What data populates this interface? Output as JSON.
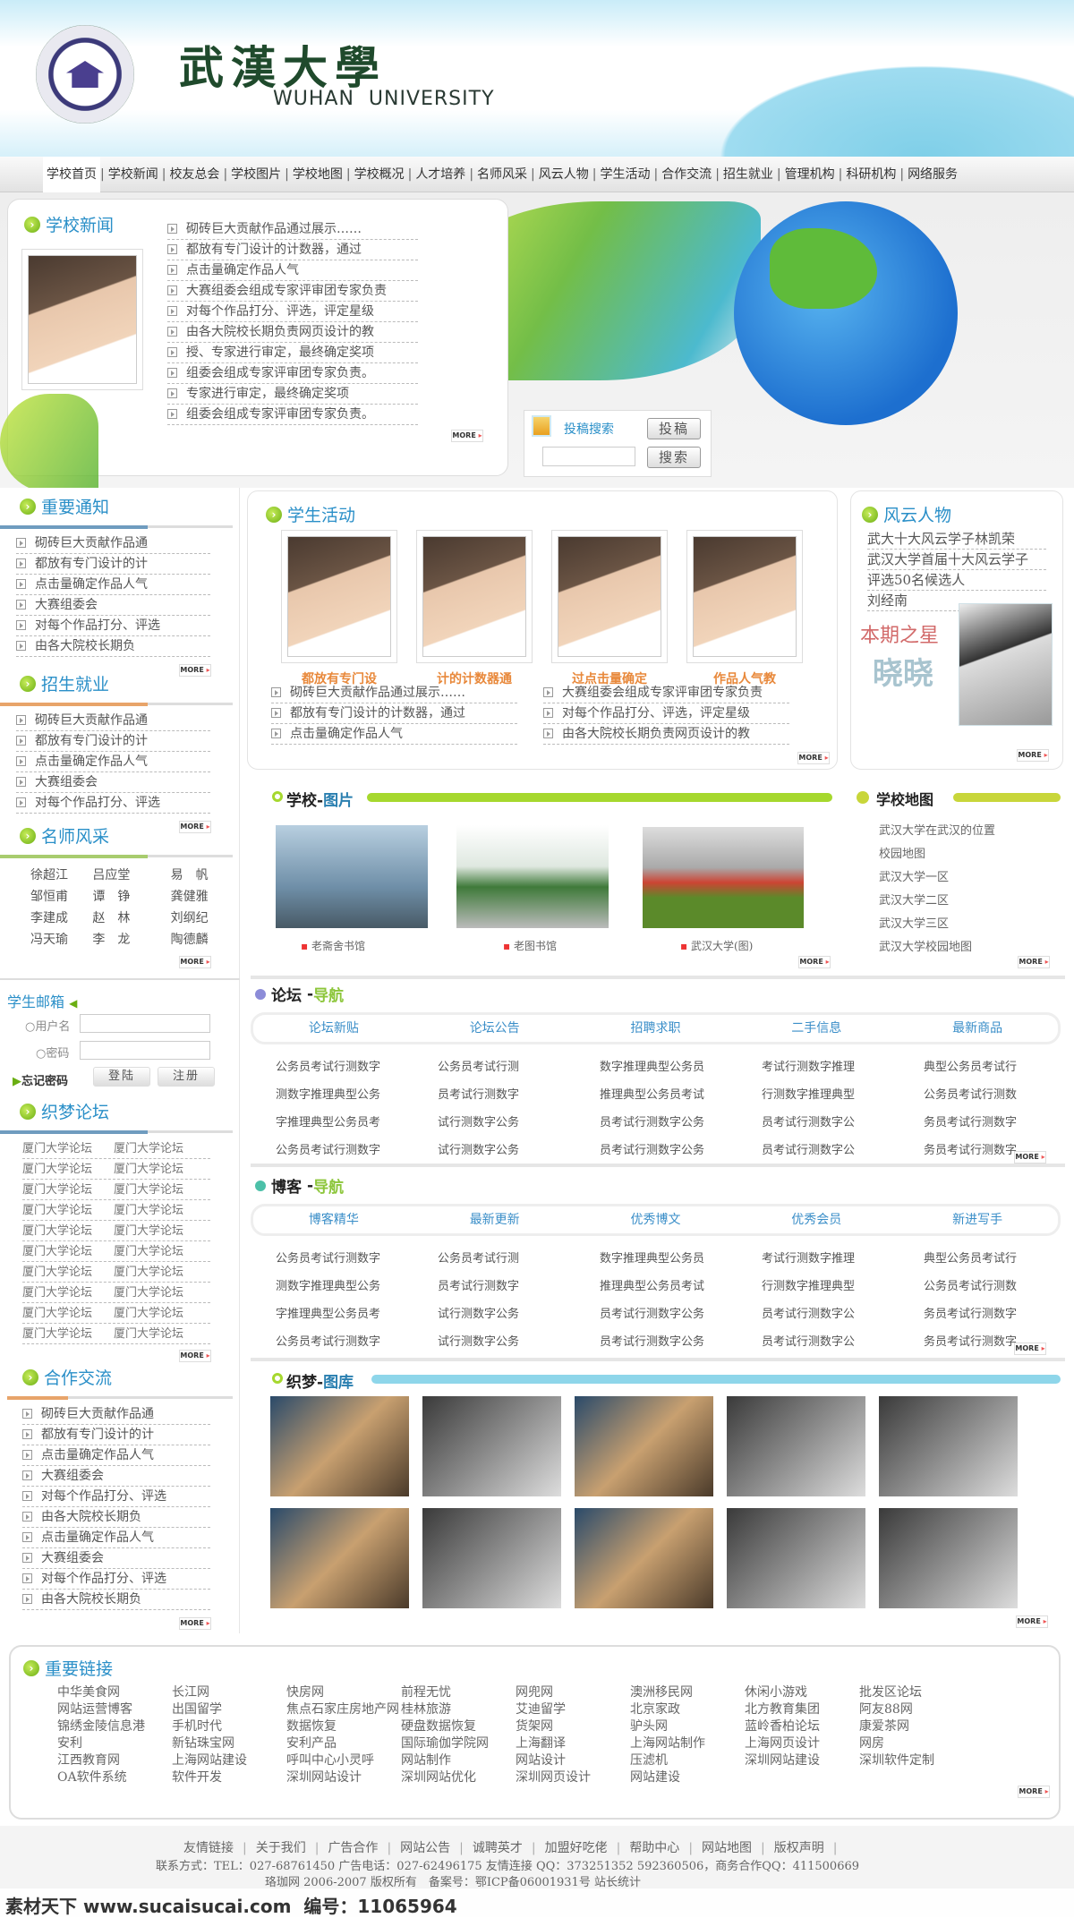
{
  "header": {
    "title_cn": "武漢大學",
    "title_en": "WUHAN  UNIVERSITY",
    "logo_text": "WUHAN UNIVERSITY"
  },
  "nav": [
    "学校首页",
    "学校新闻",
    "校友总会",
    "学校图片",
    "学校地图",
    "学校概况",
    "人才培养",
    "名师风采",
    "风云人物",
    "学生活动",
    "合作交流",
    "招生就业",
    "管理机构",
    "科研机构",
    "网络服务"
  ],
  "more_label": "MORE",
  "news": {
    "title": "学校新闻",
    "items": [
      "砌砖巨大贡献作品通过展示……",
      "都放有专门设计的计数器，通过",
      "点击量确定作品人气",
      "大赛组委会组成专家评审团专家负责",
      "对每个作品打分、评选，评定星级",
      "由各大院校长期负责网页设计的教",
      "授、专家进行审定，最终确定奖项",
      "组委会组成专家评审团专家负责。",
      "专家进行审定，最终确定奖项",
      "组委会组成专家评审团专家负责。"
    ]
  },
  "search": {
    "title": "投稿搜索",
    "submit_label": "投稿",
    "search_label": "搜索",
    "value": ""
  },
  "notice": {
    "title": "重要通知",
    "items": [
      "砌砖巨大贡献作品通",
      "都放有专门设计的计",
      "点击量确定作品人气",
      "大赛组委会",
      "对每个作品打分、评选",
      "由各大院校长期负"
    ]
  },
  "admission": {
    "title": "招生就业",
    "items": [
      "砌砖巨大贡献作品通",
      "都放有专门设计的计",
      "点击量确定作品人气",
      "大赛组委会",
      "对每个作品打分、评选"
    ]
  },
  "teachers": {
    "title": "名师风采",
    "rows": [
      [
        "徐超江",
        "吕应堂",
        "易　帆"
      ],
      [
        "邹恒甫",
        "谭　铮",
        "龚健雅"
      ],
      [
        "李建成",
        "赵　林",
        "刘纲纪"
      ],
      [
        "冯天瑜",
        "李　龙",
        "陶德麟"
      ]
    ]
  },
  "activities": {
    "title": "学生活动",
    "captions": [
      "都放有专门设",
      "计的计数器通",
      "过点击量确定",
      "作品人气教"
    ],
    "left_items": [
      "砌砖巨大贡献作品通过展示……",
      "都放有专门设计的计数器，通过",
      "点击量确定作品人气"
    ],
    "right_items": [
      "大赛组委会组成专家评审团专家负责",
      "对每个作品打分、评选，评定星级",
      "由各大院校长期负责网页设计的教"
    ]
  },
  "people": {
    "title": "风云人物",
    "items": [
      "武大十大风云学子林凯荣",
      "武汉大学首届十大风云学子",
      "评选50名候选人",
      "刘经南"
    ],
    "star_label": "本期之星",
    "star_name": "晓晓"
  },
  "pictures": {
    "title_a": "学校",
    "title_b": "图片",
    "captions": [
      "老斋舍书馆",
      "老图书馆",
      "武汉大学(图)"
    ]
  },
  "map": {
    "title": "学校地图",
    "items": [
      "武汉大学在武汉的位置",
      "校园地图",
      "武汉大学一区",
      "武汉大学二区",
      "武汉大学三区",
      "武汉大学校园地图"
    ]
  },
  "mail": {
    "title": "学生邮箱",
    "username_label": "○用户名",
    "password_label": "○密码",
    "username": "",
    "password": "",
    "forgot_label": "忘记密码",
    "login_label": "登陆",
    "register_label": "注册"
  },
  "forum_list": {
    "title": "织梦论坛",
    "rows": [
      [
        "厦门大学论坛",
        "厦门大学论坛"
      ],
      [
        "厦门大学论坛",
        "厦门大学论坛"
      ],
      [
        "厦门大学论坛",
        "厦门大学论坛"
      ],
      [
        "厦门大学论坛",
        "厦门大学论坛"
      ],
      [
        "厦门大学论坛",
        "厦门大学论坛"
      ],
      [
        "厦门大学论坛",
        "厦门大学论坛"
      ],
      [
        "厦门大学论坛",
        "厦门大学论坛"
      ],
      [
        "厦门大学论坛",
        "厦门大学论坛"
      ],
      [
        "厦门大学论坛",
        "厦门大学论坛"
      ],
      [
        "厦门大学论坛",
        "厦门大学论坛"
      ]
    ]
  },
  "coop": {
    "title": "合作交流",
    "items": [
      "砌砖巨大贡献作品通",
      "都放有专门设计的计",
      "点击量确定作品人气",
      "大赛组委会",
      "对每个作品打分、评选",
      "由各大院校长期负",
      "点击量确定作品人气",
      "大赛组委会",
      "对每个作品打分、评选",
      "由各大院校长期负"
    ]
  },
  "forum_nav": {
    "title_a": "论坛",
    "title_b": "导航",
    "tabs": [
      "论坛新贴",
      "论坛公告",
      "招聘求职",
      "二手信息",
      "最新商品"
    ],
    "rows": [
      [
        "公务员考试行测数字",
        "公务员考试行测",
        "数字推理典型公务员",
        "考试行测数字推理",
        "典型公务员考试行"
      ],
      [
        "测数字推理典型公务",
        "员考试行测数字",
        "推理典型公务员考试",
        "行测数字推理典型",
        "公务员考试行测数"
      ],
      [
        "字推理典型公务员考",
        "试行测数字公务",
        "员考试行测数字公务",
        "员考试行测数字公",
        "务员考试行测数字"
      ],
      [
        "公务员考试行测数字",
        "试行测数字公务",
        "员考试行测数字公务",
        "员考试行测数字公",
        "务员考试行测数字"
      ]
    ]
  },
  "blog_nav": {
    "title_a": "博客",
    "title_b": "导航",
    "tabs": [
      "博客精华",
      "最新更新",
      "优秀博文",
      "优秀会员",
      "新进写手"
    ],
    "rows": [
      [
        "公务员考试行测数字",
        "公务员考试行测",
        "数字推理典型公务员",
        "考试行测数字推理",
        "典型公务员考试行"
      ],
      [
        "测数字推理典型公务",
        "员考试行测数字",
        "推理典型公务员考试",
        "行测数字推理典型",
        "公务员考试行测数"
      ],
      [
        "字推理典型公务员考",
        "试行测数字公务",
        "员考试行测数字公务",
        "员考试行测数字公",
        "务员考试行测数字"
      ],
      [
        "公务员考试行测数字",
        "试行测数字公务",
        "员考试行测数字公务",
        "员考试行测数字公",
        "务员考试行测数字"
      ]
    ]
  },
  "gallery": {
    "title_a": "织梦",
    "title_b": "图库"
  },
  "links": {
    "title": "重要链接",
    "columns": [
      [
        "中华美食网",
        "网站运营博客",
        "锦绣金陵信息港",
        "安利",
        "江西教育网",
        "OA软件系统"
      ],
      [
        "长江网",
        "出国留学",
        "手机时代",
        "新钻珠宝网",
        "上海网站建设",
        "软件开发"
      ],
      [
        "快房网",
        "焦点石家庄房地产网",
        "数据恢复",
        "安利产品",
        "呼叫中心小灵呼",
        "深圳网站设计"
      ],
      [
        "前程无忧",
        "桂林旅游",
        "硬盘数据恢复",
        "国际瑜伽学院网",
        "网站制作",
        "深圳网站优化"
      ],
      [
        "网兜网",
        "艾迪留学",
        "货架网",
        "上海翻译",
        "网站设计",
        "深圳网页设计"
      ],
      [
        "澳洲移民网",
        "北京家政",
        "驴头网",
        "上海网站制作",
        "压滤机",
        "网站建设"
      ],
      [
        "休闲小游戏",
        "北方教育集团",
        "蓝岭香柏论坛",
        "上海网页设计",
        "深圳网站建设"
      ],
      [
        "批发区论坛",
        "阿友88网",
        "康爱茶网",
        "网房",
        "深圳软件定制"
      ]
    ]
  },
  "footer": {
    "links": [
      "友情链接",
      "关于我们",
      "广告合作",
      "网站公告",
      "诚聘英才",
      "加盟好吃佬",
      "帮助中心",
      "网站地图",
      "版权声明"
    ],
    "contact": "联系方式：TEL：027-68761450 广告电话：027-62496175 友情连接 QQ：373251352 592360506，商务合作QQ：411500669",
    "copyright": "珞珈网 2006-2007 版权所有　备案号：鄂ICP备06001931号 站长统计"
  },
  "watermark": "素材天下 www.sucaisucai.com  编号：11065964",
  "colors": {
    "heading_blue": "#2a8fc8",
    "lime": "#a6d82e",
    "cyan_bar": "#8ed6ea",
    "orange_caption": "#e8883a",
    "map_bar": "#c8d63a"
  }
}
